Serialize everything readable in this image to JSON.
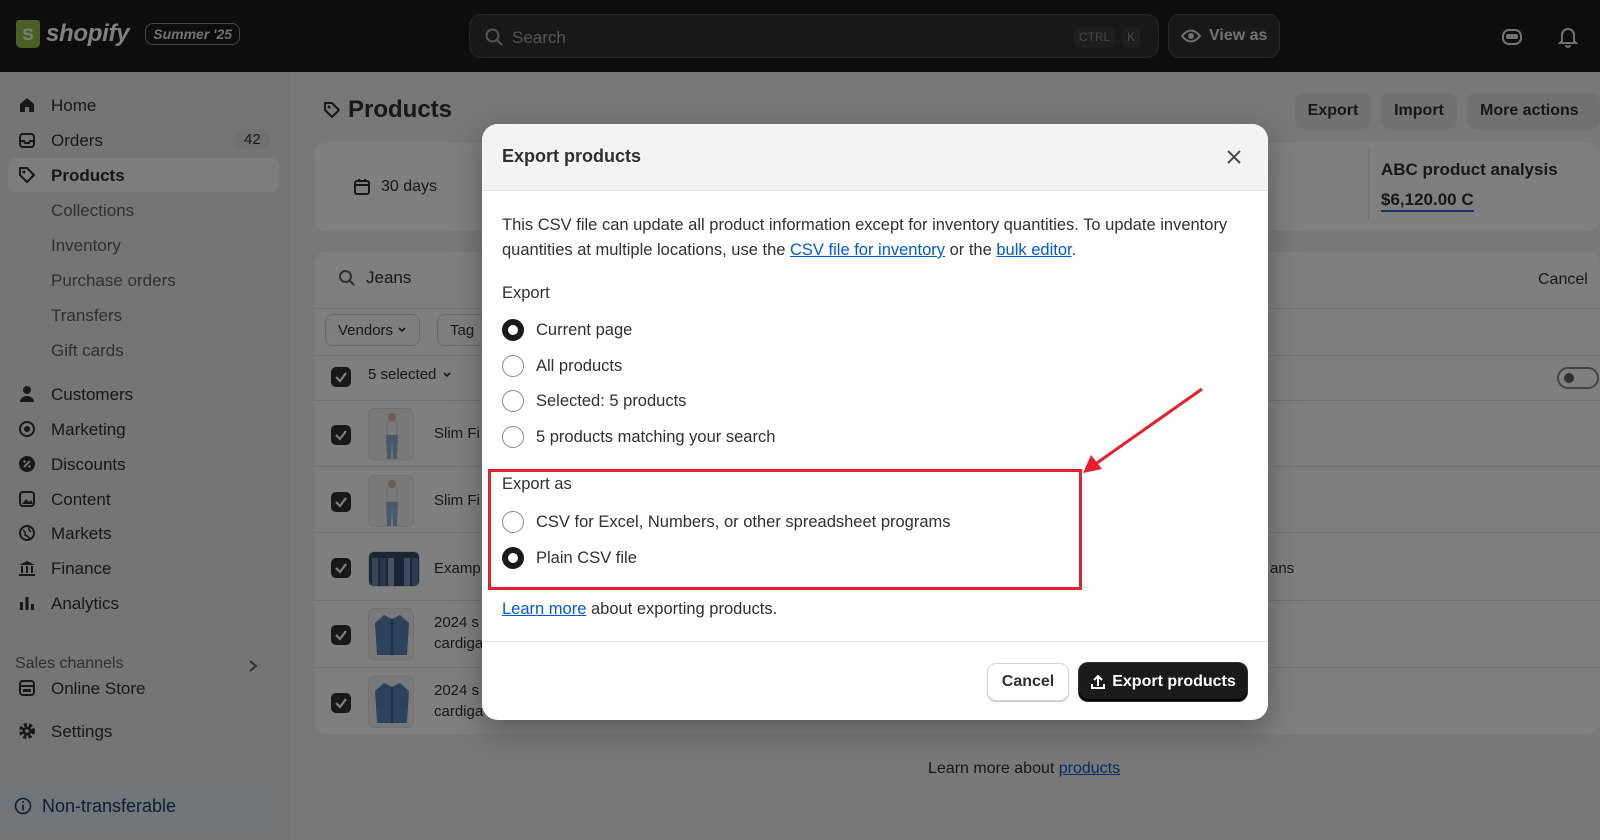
{
  "topbar": {
    "logo_text": "shopify",
    "edition": "Summer '25",
    "search_placeholder": "Search",
    "shortcut_ctrl": "CTRL",
    "shortcut_k": "K",
    "view_as": "View as"
  },
  "sidebar": {
    "home": "Home",
    "orders": "Orders",
    "orders_count": "42",
    "products": "Products",
    "collections": "Collections",
    "inventory": "Inventory",
    "purchase_orders": "Purchase orders",
    "transfers": "Transfers",
    "gift_cards": "Gift cards",
    "customers": "Customers",
    "marketing": "Marketing",
    "discounts": "Discounts",
    "content": "Content",
    "markets": "Markets",
    "finance": "Finance",
    "analytics": "Analytics",
    "sales_channels": "Sales channels",
    "online_store": "Online Store",
    "settings": "Settings",
    "non_transferable": "Non-transferable"
  },
  "main": {
    "title": "Products",
    "export": "Export",
    "import": "Import",
    "more_actions": "More actions",
    "days": "30 days",
    "abc_title": "ABC product analysis",
    "abc_value": "$6,120.00 C",
    "search_value": "Jeans",
    "cancel": "Cancel",
    "vendors": "Vendors",
    "tag": "Tag",
    "selected": "5 selected",
    "rows": [
      {
        "line1": "Slim Fi",
        "line2": ""
      },
      {
        "line1": "Slim Fi",
        "line2": ""
      },
      {
        "line1": "Examp",
        "line2": ""
      },
      {
        "line1": "2024 s",
        "line2": "cardiga"
      },
      {
        "line1": "2024 s",
        "line2": "cardiga"
      }
    ],
    "row3_right": "ans",
    "footer_prefix": "Learn more about ",
    "footer_link": "products"
  },
  "modal": {
    "title": "Export products",
    "desc_1": "This CSV file can update all product information except for inventory quantities. To update inventory quantities at multiple locations, use the ",
    "desc_link_1": "CSV file for inventory",
    "desc_2": " or the ",
    "desc_link_2": "bulk editor",
    "desc_3": ".",
    "export_label": "Export",
    "export_options": [
      "Current page",
      "All products",
      "Selected: 5 products",
      "5 products matching your search"
    ],
    "export_selected": "Current page",
    "export_as_label": "Export as",
    "export_as_options": [
      "CSV for Excel, Numbers, or other spreadsheet programs",
      "Plain CSV file"
    ],
    "export_as_selected": "Plain CSV file",
    "learn_link": "Learn more",
    "learn_rest": " about exporting products.",
    "cancel": "Cancel",
    "submit": "Export products"
  },
  "colors": {
    "highlight": "#e5202c",
    "primary_button": "#1a1a1a",
    "link": "#005bd3"
  }
}
